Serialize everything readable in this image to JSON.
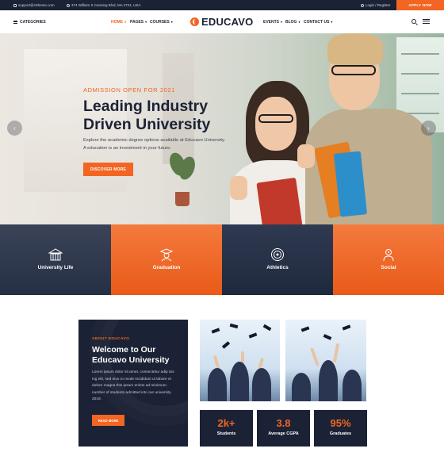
{
  "topbar": {
    "email": "support@rstheme.com",
    "address": "374 William S Canning Blvd, MA 2721, USA",
    "login": "Login / Register",
    "apply": "APPLY NOW"
  },
  "nav": {
    "categories": "CATEGORIES",
    "left_links": [
      "HOME",
      "PAGES",
      "COURSES"
    ],
    "right_links": [
      "EVENTS",
      "BLOG",
      "CONTACT US"
    ],
    "logo": "EDUCAVO"
  },
  "hero": {
    "subtitle": "ADMISSION OPEN FOR 2021",
    "title": "Leading Industry Driven University",
    "description": "Explore the academic degree options available at Educavo University. A education is an investment in your future.",
    "button": "DISCOVER MORE"
  },
  "categories": [
    {
      "label": "University Life",
      "icon": "university-icon",
      "color": "#263045"
    },
    {
      "label": "Graduation",
      "icon": "graduate-icon",
      "color": "#f26522"
    },
    {
      "label": "Athletics",
      "icon": "target-icon",
      "color": "#263045"
    },
    {
      "label": "Social",
      "icon": "social-icon",
      "color": "#f26522"
    }
  ],
  "about": {
    "tag": "ABOUT EDUCAVO",
    "title": "Welcome to Our Educavo University",
    "text": "Lorem ipsum dolor sit amet, consectetur adip isic ing elit, sed eius to mode incididunt ut labore et dolore magna this ipsum enims ad minimum number of students admitted into our university 2019.",
    "button": "READ MORE"
  },
  "stats": [
    {
      "value": "2k+",
      "label": "Students"
    },
    {
      "value": "3.8",
      "label": "Average CGPA"
    },
    {
      "value": "95%",
      "label": "Graduates"
    }
  ],
  "colors": {
    "accent": "#f26522",
    "navy": "#1b2235"
  }
}
